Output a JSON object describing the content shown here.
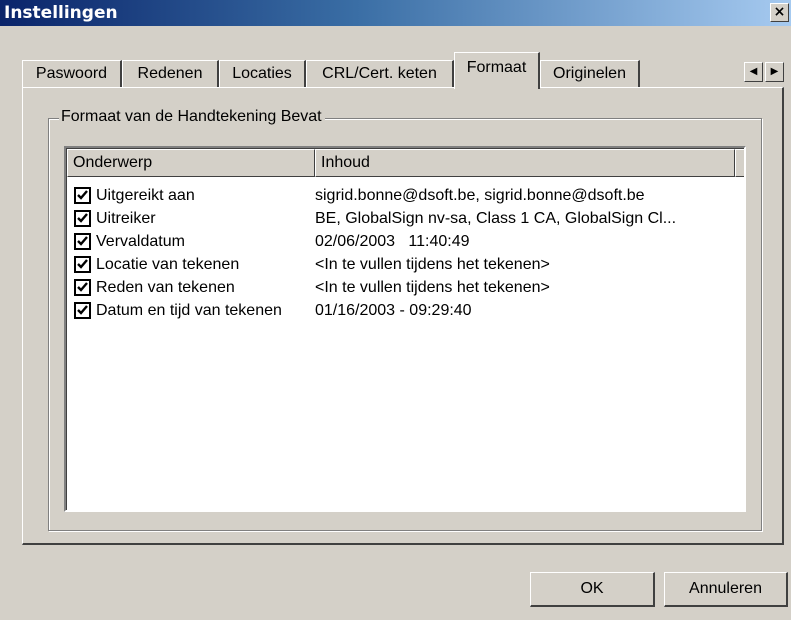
{
  "window": {
    "title": "Instellingen",
    "close_glyph": "×"
  },
  "tabs": [
    {
      "label": "Paswoord",
      "active": false
    },
    {
      "label": "Redenen",
      "active": false
    },
    {
      "label": "Locaties",
      "active": false
    },
    {
      "label": "CRL/Cert. keten",
      "active": false
    },
    {
      "label": "Formaat",
      "active": true
    },
    {
      "label": "Originelen",
      "active": false
    }
  ],
  "tab_scroll": {
    "left_icon": "arrow-left-icon",
    "right_icon": "arrow-right-icon",
    "left_glyph": "◀",
    "right_glyph": "▶"
  },
  "groupbox": {
    "label": "Formaat van de Handtekening Bevat"
  },
  "list": {
    "columns": [
      "Onderwerp",
      "Inhoud"
    ],
    "rows": [
      {
        "checked": true,
        "subject": "Uitgereikt aan",
        "content": "sigrid.bonne@dsoft.be, sigrid.bonne@dsoft.be"
      },
      {
        "checked": true,
        "subject": "Uitreiker",
        "content": "BE, GlobalSign nv-sa, Class 1 CA, GlobalSign Cl..."
      },
      {
        "checked": true,
        "subject": "Vervaldatum",
        "content": "02/06/2003   11:40:49"
      },
      {
        "checked": true,
        "subject": "Locatie van tekenen",
        "content": "<In te vullen tijdens het tekenen>"
      },
      {
        "checked": true,
        "subject": "Reden van tekenen",
        "content": "<In te vullen tijdens het tekenen>"
      },
      {
        "checked": true,
        "subject": "Datum en tijd van tekenen",
        "content": "01/16/2003 - 09:29:40"
      }
    ]
  },
  "buttons": {
    "ok": "OK",
    "cancel": "Annuleren"
  }
}
